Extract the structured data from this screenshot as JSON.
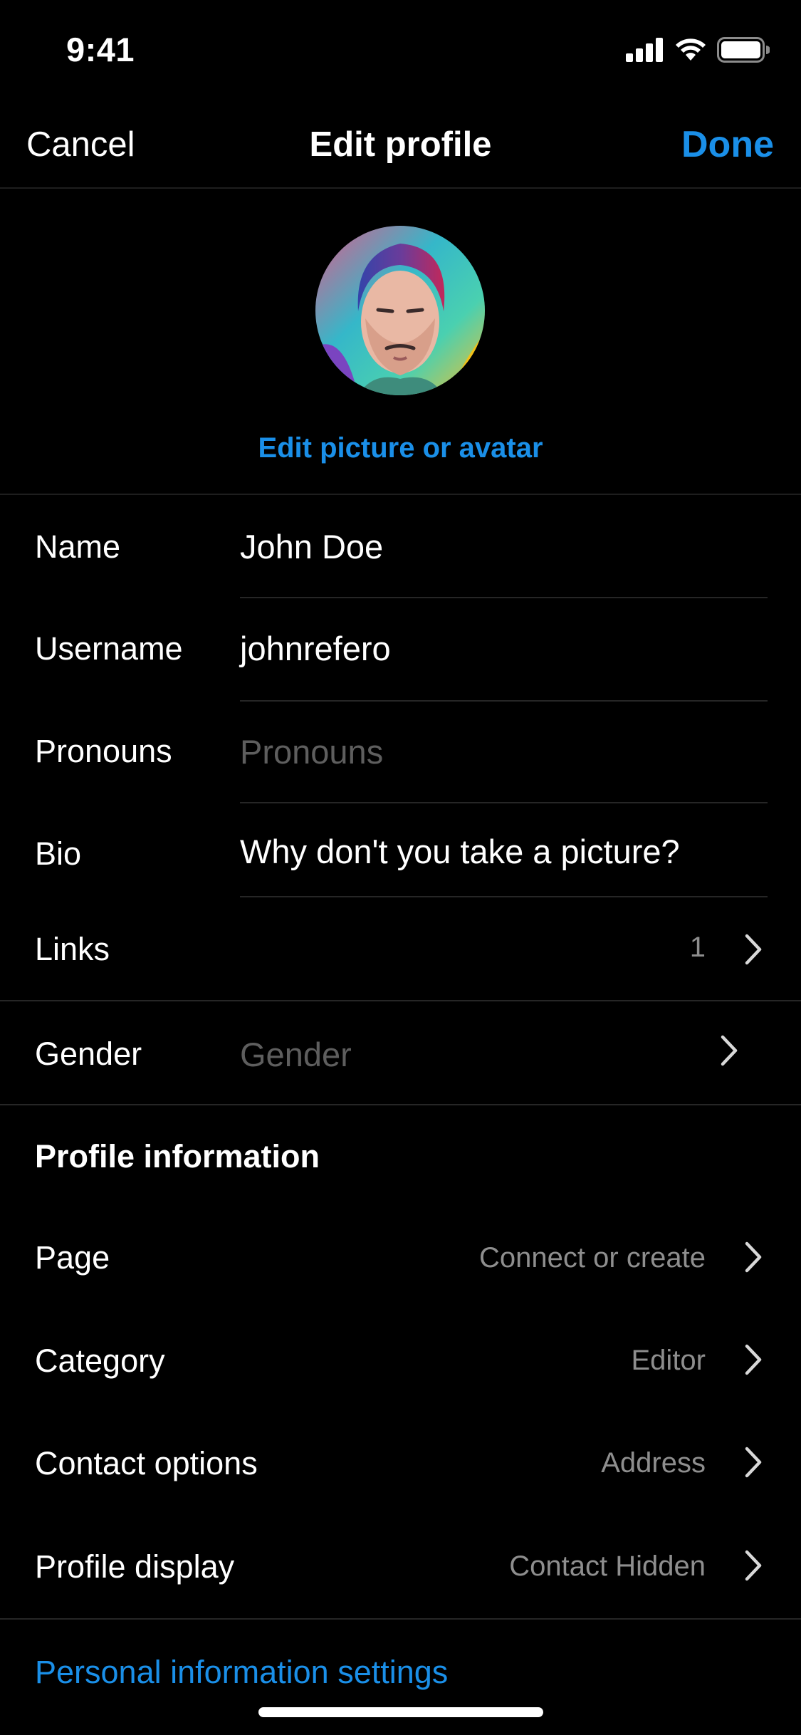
{
  "status_bar": {
    "time": "9:41"
  },
  "nav": {
    "cancel": "Cancel",
    "title": "Edit profile",
    "done": "Done"
  },
  "avatar": {
    "edit_label": "Edit picture or avatar"
  },
  "fields": {
    "name": {
      "label": "Name",
      "value": "John Doe"
    },
    "username": {
      "label": "Username",
      "value": "johnrefero"
    },
    "pronouns": {
      "label": "Pronouns",
      "placeholder": "Pronouns"
    },
    "bio": {
      "label": "Bio",
      "value": "Why don't you take a picture?"
    },
    "links": {
      "label": "Links",
      "count": "1"
    },
    "gender": {
      "label": "Gender",
      "placeholder": "Gender"
    }
  },
  "profile_information": {
    "title": "Profile information",
    "rows": [
      {
        "label": "Page",
        "value": "Connect or create"
      },
      {
        "label": "Category",
        "value": "Editor"
      },
      {
        "label": "Contact options",
        "value": "Address"
      },
      {
        "label": "Profile display",
        "value": "Contact Hidden"
      }
    ]
  },
  "footer": {
    "personal_settings": "Personal information settings"
  },
  "colors": {
    "accent": "#1a8fe8",
    "background": "#000000",
    "muted": "#8e8e8e",
    "placeholder": "#5e5e5e"
  }
}
